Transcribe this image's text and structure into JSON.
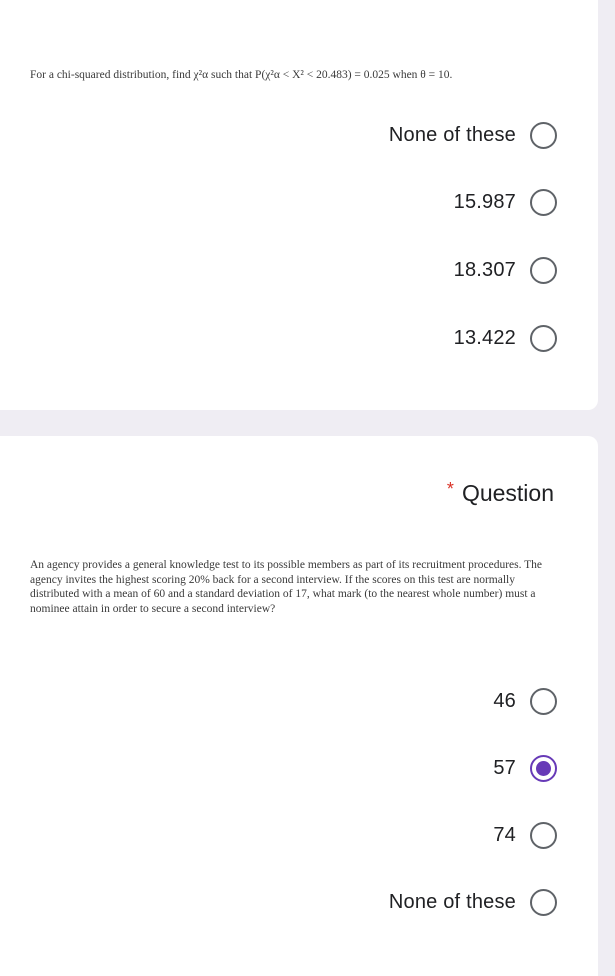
{
  "question1": {
    "text": "For a chi-squared distribution, find χ²α such that P(χ²α < X² < 20.483) = 0.025 when θ = 10.",
    "options": [
      {
        "label": "None of these",
        "selected": false
      },
      {
        "label": "15.987",
        "selected": false
      },
      {
        "label": "18.307",
        "selected": false
      },
      {
        "label": "13.422",
        "selected": false
      }
    ]
  },
  "question2": {
    "required_mark": "*",
    "title": "Question",
    "text": "An agency provides a general knowledge test to its possible members as part of its recruitment procedures. The agency invites the highest scoring 20% back for a second interview. If the scores on this test are normally distributed with a mean of 60 and a standard deviation of 17, what mark (to the nearest whole number) must a nominee attain in order to secure a second interview?",
    "options": [
      {
        "label": "46",
        "selected": false
      },
      {
        "label": "57",
        "selected": true
      },
      {
        "label": "74",
        "selected": false
      },
      {
        "label": "None of these",
        "selected": false
      }
    ]
  },
  "colors": {
    "accent": "#673ab7",
    "required": "#d93025",
    "background": "#efedf3"
  }
}
